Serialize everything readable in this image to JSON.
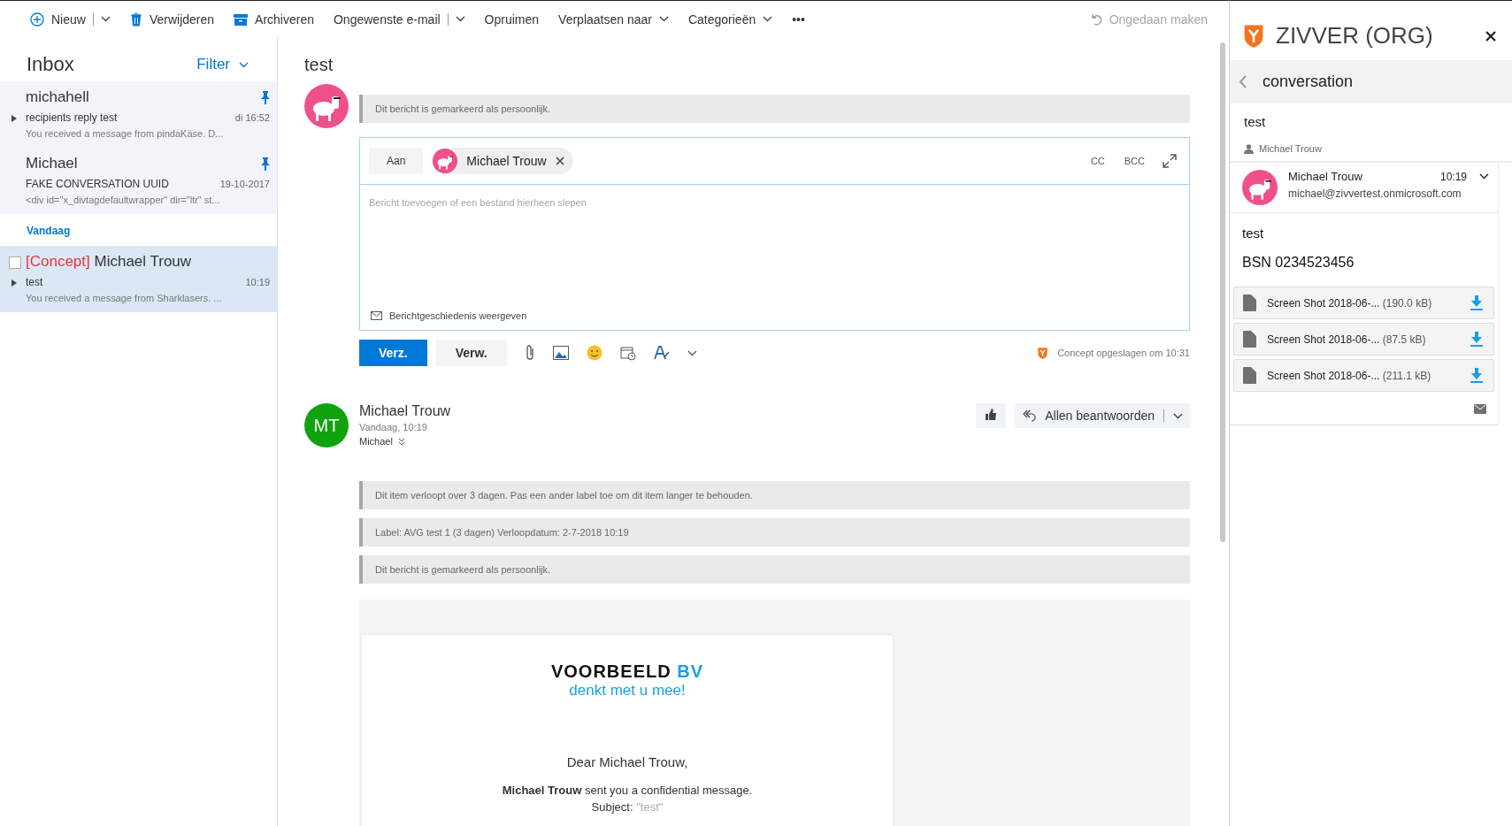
{
  "toolbar": {
    "items": [
      {
        "kind": "new",
        "label": "Nieuw",
        "disabled": false
      },
      {
        "kind": "delete",
        "label": "Verwijderen",
        "disabled": false
      },
      {
        "kind": "archive",
        "label": "Archiveren",
        "disabled": false
      },
      {
        "kind": "split",
        "label": "Ongewenste e-mail",
        "disabled": false
      },
      {
        "kind": "plain",
        "label": "Opruimen",
        "disabled": false
      },
      {
        "kind": "dropdown",
        "label": "Verplaatsen naar",
        "disabled": false
      },
      {
        "kind": "dropdown",
        "label": "Categorieën",
        "disabled": false
      },
      {
        "kind": "plain",
        "label": "•••",
        "disabled": false
      }
    ],
    "undo": {
      "label": "Ongedaan maken",
      "disabled": true
    }
  },
  "message_list": {
    "title": "Inbox",
    "filter": "Filter",
    "items": [
      {
        "kind": "message",
        "sender": "michahell",
        "subject": "recipients reply test",
        "time": "di 16:52",
        "preview": "You received a message from pindaKäse.    D...",
        "pinned": true,
        "thread": true,
        "selected": false,
        "checked": false
      },
      {
        "kind": "message",
        "sender": "Michael",
        "subject": "FAKE CONVERSATION UUID",
        "time": "19-10-2017",
        "preview": "<div id=\"x_divtagdefaultwrapper\" dir=\"ltr\" st...",
        "pinned": true,
        "thread": false,
        "selected": false,
        "checked": false
      },
      {
        "kind": "group",
        "label": "Vandaag"
      },
      {
        "kind": "message",
        "draft_tag": "[Concept]",
        "sender": "Michael Trouw",
        "subject": "test",
        "time": "10:19",
        "preview": "You received a message from Sharklasers.    ...",
        "pinned": false,
        "thread": true,
        "selected": true,
        "checked": false
      }
    ]
  },
  "reading_pane": {
    "subject": "test",
    "draft": {
      "notice": "Dit bericht is gemarkeerd als persoonlijk.",
      "to_label": "Aan",
      "recipient": "Michael Trouw",
      "cc": "CC",
      "bcc": "BCC",
      "placeholder": "Bericht toevoegen of een bestand hierheen slepen",
      "history": "Berichtgeschiedenis weergeven",
      "send": "Verz.",
      "discard": "Verw.",
      "saved": "Concept opgeslagen om 10:31"
    },
    "message": {
      "initials": "MT",
      "sender": "Michael Trouw",
      "time": "Vandaag, 10:19",
      "to": "Michael",
      "reply": "Allen beantwoorden",
      "notices": [
        "Dit item verloopt over 3 dagen. Pas een ander label toe om dit item langer te behouden.",
        "Label: AVG test 1 (3 dagen) Verloopdatum: 2-7-2018 10:19",
        "Dit bericht is gemarkeerd als persoonlijk."
      ],
      "body": {
        "brand": "VOORBEELD",
        "brand_accent": "BV",
        "tagline": "denkt met u mee!",
        "greeting": "Dear Michael Trouw,",
        "line": "**Michael Trouw** sent you a confidential message.",
        "subject_label": "Subject:",
        "subject_value": "\"test\""
      }
    }
  },
  "addin": {
    "title": "ZIVVER (ORG)",
    "view": "conversation",
    "subject": "test",
    "participant": "Michael Trouw",
    "message": {
      "sender": "Michael Trouw",
      "time": "10:19",
      "email": "michael@zivvertest.onmicrosoft.com",
      "lines": [
        "test",
        "BSN 0234523456"
      ],
      "attachments": [
        {
          "name": "Screen Shot 2018-06-...",
          "size": "(190.0 kB)"
        },
        {
          "name": "Screen Shot 2018-06-...",
          "size": "(87.5 kB)"
        },
        {
          "name": "Screen Shot 2018-06-...",
          "size": "(211.1 kB)"
        }
      ]
    }
  }
}
